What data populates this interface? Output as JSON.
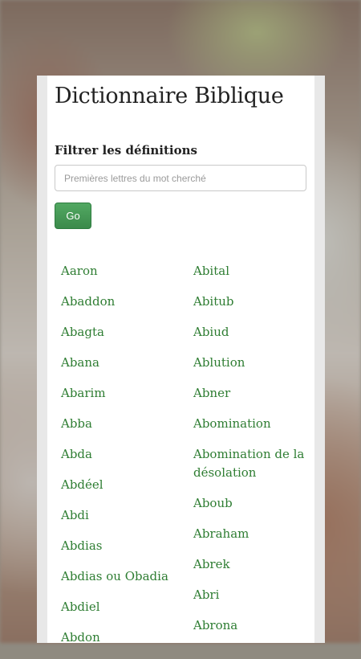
{
  "title": "Dictionnaire Biblique",
  "filter": {
    "label": "Filtrer les définitions",
    "placeholder": "Premières lettres du mot cherché",
    "value": "",
    "button": "Go"
  },
  "entries": {
    "left": [
      "Aaron",
      "Abaddon",
      "Abagta",
      "Abana",
      "Abarim",
      "Abba",
      "Abda",
      "Abdéel",
      "Abdi",
      "Abdias",
      "Abdias ou Obadia",
      "Abdiel",
      "Abdon"
    ],
    "right": [
      "Abital",
      "Abitub",
      "Abiud",
      "Ablution",
      "Abner",
      "Abomination",
      "Abomination de la désolation",
      "Aboub",
      "Abraham",
      "Abrek",
      "Abri",
      "Abrona"
    ]
  },
  "colors": {
    "link": "#2e7d32",
    "button": "#3f8f4f"
  }
}
